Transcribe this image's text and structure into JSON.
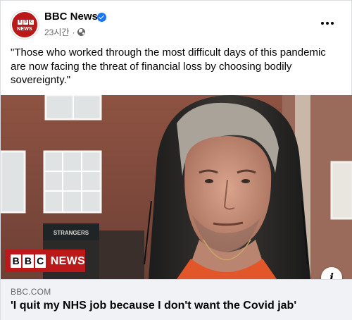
{
  "post": {
    "page_name": "BBC News",
    "avatar_blocks": [
      "B",
      "B",
      "C"
    ],
    "avatar_word": "NEWS",
    "time_ago": "23시간",
    "separator": "·",
    "privacy_icon": "globe-icon",
    "verified_icon": "verified-badge-icon",
    "more_icon": "ellipsis-icon",
    "caption": "\"Those who worked through the most difficult days of this pandemic are now facing the threat of financial loss by choosing bodily sovereignty.\""
  },
  "image": {
    "overlay_logo_blocks": [
      "B",
      "B",
      "C"
    ],
    "overlay_logo_word": "NEWS",
    "shop_sign": "STRANGERS",
    "info_icon": "info-icon",
    "info_glyph": "i"
  },
  "link_preview": {
    "domain": "BBC.COM",
    "headline": "'I quit my NHS job because I don't want the Covid jab'"
  },
  "colors": {
    "bbc_red": "#bb1919",
    "verified_blue": "#1877f2",
    "secondary_text": "#65676b",
    "link_bg": "#f0f2f5"
  }
}
